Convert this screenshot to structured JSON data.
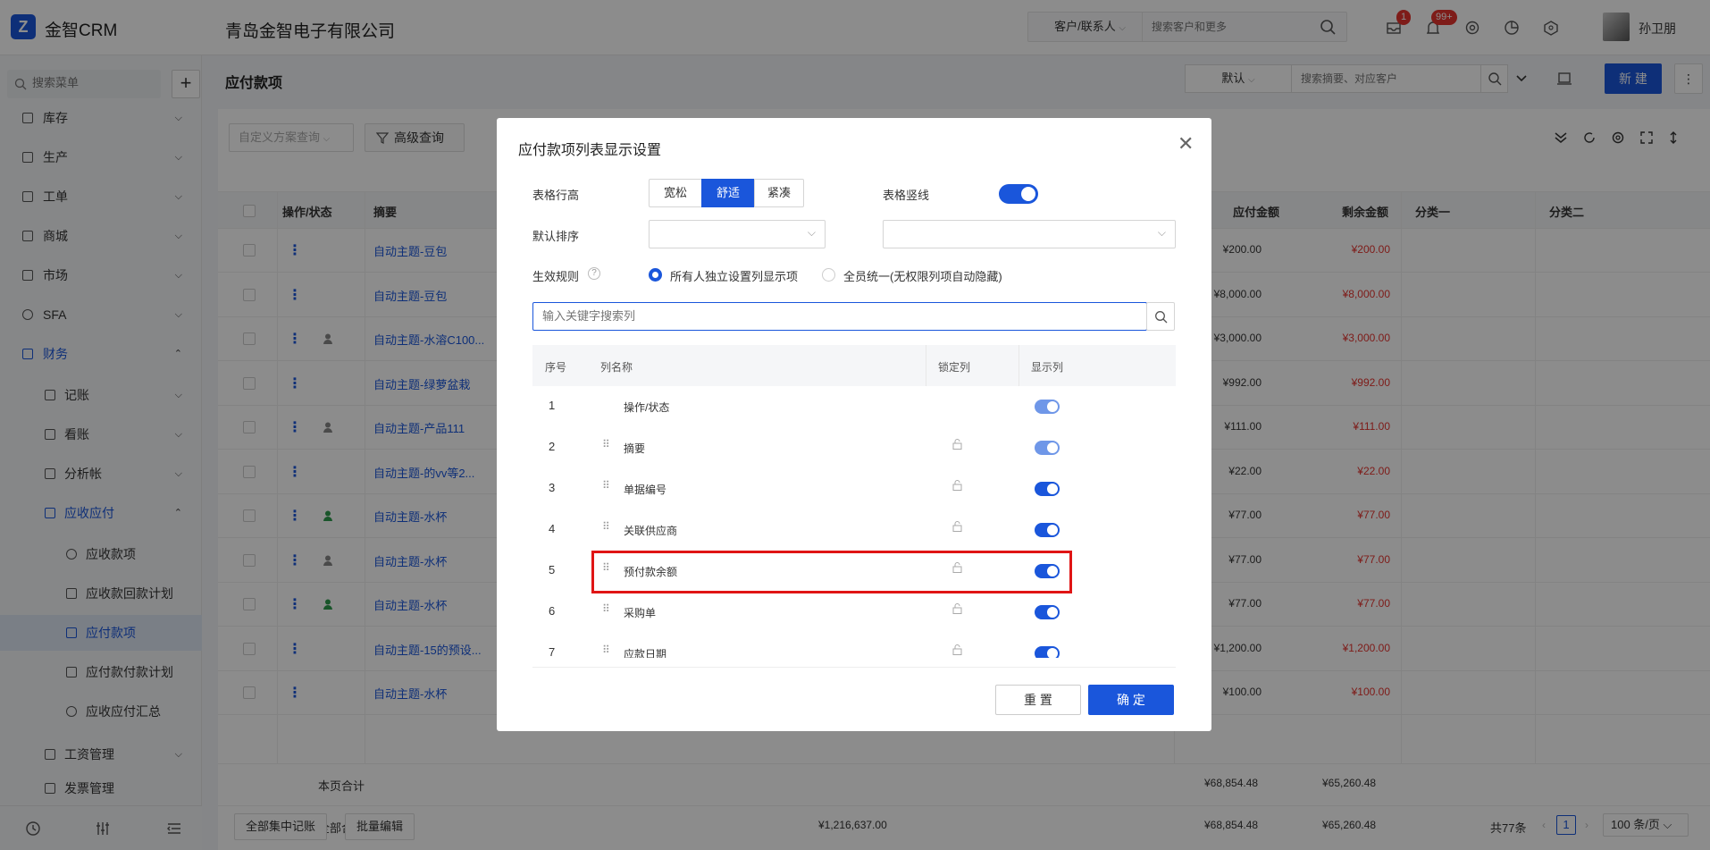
{
  "app": {
    "name": "金智CRM",
    "company": "青岛金智电子有限公司",
    "user": "孙卫朋"
  },
  "topbar": {
    "scope": "客户/联系人",
    "search_placeholder": "搜索客户和更多",
    "badge_msg": "1",
    "badge_notice": "99+"
  },
  "sidebar": {
    "search_placeholder": "搜索菜单",
    "items": [
      {
        "label": "库存"
      },
      {
        "label": "生产"
      },
      {
        "label": "工单"
      },
      {
        "label": "商城"
      },
      {
        "label": "市场"
      },
      {
        "label": "SFA"
      },
      {
        "label": "财务"
      },
      {
        "label": "记账"
      },
      {
        "label": "看账"
      },
      {
        "label": "分析帐"
      },
      {
        "label": "应收应付"
      },
      {
        "label": "应收款项"
      },
      {
        "label": "应收款回款计划"
      },
      {
        "label": "应付款项"
      },
      {
        "label": "应付款付款计划"
      },
      {
        "label": "应收应付汇总"
      },
      {
        "label": "工资管理"
      },
      {
        "label": "发票管理"
      }
    ]
  },
  "page": {
    "title": "应付款项",
    "view": "默认",
    "search_placeholder": "搜索摘要、对应客户",
    "new_label": "新 建",
    "filter_placeholder": "自定义方案查询",
    "advanced_query": "高级查询",
    "columns": {
      "op": "操作/状态",
      "summary": "摘要",
      "amount": "应付金额",
      "remaining": "剩余金额",
      "cat1": "分类一",
      "cat2": "分类二"
    },
    "rows": [
      {
        "summary": "自动主题-豆包",
        "amount": "¥200.00",
        "remaining": "¥200.00"
      },
      {
        "summary": "自动主题-豆包",
        "amount": "¥8,000.00",
        "remaining": "¥8,000.00"
      },
      {
        "summary": "自动主题-水溶C100...",
        "amount": "¥3,000.00",
        "remaining": "¥3,000.00"
      },
      {
        "summary": "自动主题-绿萝盆栽",
        "amount": "¥992.00",
        "remaining": "¥992.00"
      },
      {
        "summary": "自动主题-产品111",
        "amount": "¥111.00",
        "remaining": "¥111.00"
      },
      {
        "summary": "自动主题-的vv等2...",
        "amount": "¥22.00",
        "remaining": "¥22.00"
      },
      {
        "summary": "自动主题-水杯",
        "amount": "¥77.00",
        "remaining": "¥77.00"
      },
      {
        "summary": "自动主题-水杯",
        "amount": "¥77.00",
        "remaining": "¥77.00"
      },
      {
        "summary": "自动主题-水杯",
        "amount": "¥77.00",
        "remaining": "¥77.00"
      },
      {
        "summary": "自动主题-15的预设...",
        "amount": "¥1,200.00",
        "remaining": "¥1,200.00"
      },
      {
        "summary": "自动主题-水杯",
        "amount": "¥100.00",
        "remaining": "¥100.00"
      }
    ],
    "page_total_label": "本页合计",
    "page_total_amount": "¥68,854.48",
    "page_total_remaining": "¥65,260.48",
    "all_total_label": "全部合计",
    "all_total_mid": "¥1,216,637.00",
    "all_total_amount": "¥68,854.48",
    "all_total_remaining": "¥65,260.48",
    "btn_all_records": "全部集中记账",
    "btn_batch_edit": "批量编辑",
    "total_count": "共77条",
    "current_page": "1",
    "page_size": "100 条/页"
  },
  "modal": {
    "title": "应付款项列表显示设置",
    "row_height_label": "表格行高",
    "row_height_options": [
      "宽松",
      "舒适",
      "紧凑"
    ],
    "row_height_selected": "舒适",
    "vline_label": "表格竖线",
    "vline_on": true,
    "sort_label": "默认排序",
    "rule_label": "生效规则",
    "rule_option_1": "所有人独立设置列显示项",
    "rule_option_2": "全员统一(无权限列项自动隐藏)",
    "search_placeholder": "输入关键字搜索列",
    "head_index": "序号",
    "head_name": "列名称",
    "head_lock": "锁定列",
    "head_show": "显示列",
    "columns": [
      {
        "index": "1",
        "name": "操作/状态",
        "show": true
      },
      {
        "index": "2",
        "name": "摘要",
        "show": true
      },
      {
        "index": "3",
        "name": "单据编号",
        "show": true
      },
      {
        "index": "4",
        "name": "关联供应商",
        "show": true
      },
      {
        "index": "5",
        "name": "预付款余额",
        "show": true
      },
      {
        "index": "6",
        "name": "采购单",
        "show": true
      },
      {
        "index": "7",
        "name": "应款日期",
        "show": true
      }
    ],
    "reset": "重 置",
    "confirm": "确 定"
  }
}
